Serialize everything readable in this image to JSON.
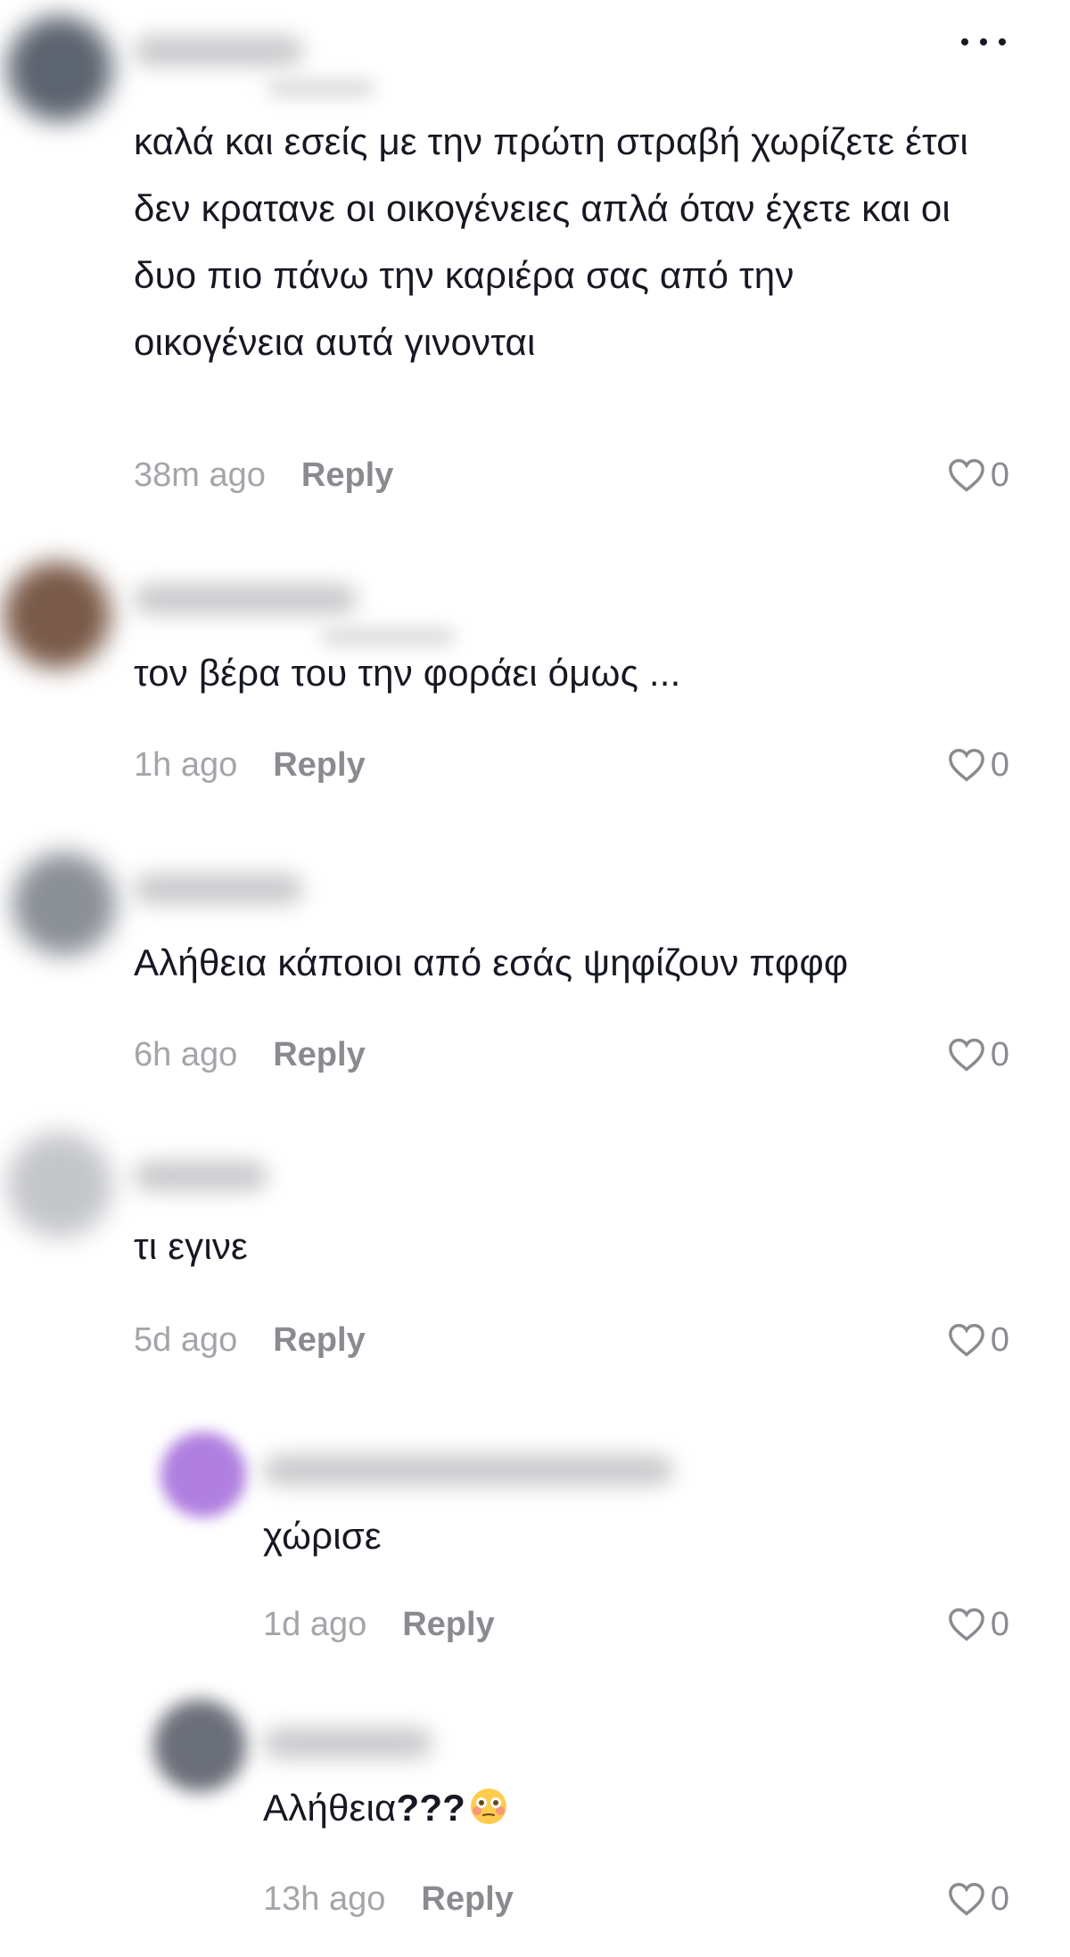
{
  "more_menu_label": "...",
  "reply_label": "Reply",
  "comments": [
    {
      "text": "καλά και εσείς με την πρώτη στραβή χωρίζετε έτσι δεν κρατανε οι οικογένειες απλά όταν έχετε και οι δυο πιο πάνω την καριέρα σας από την οικογένεια αυτά γινονται",
      "time": "38m ago",
      "likes": "0"
    },
    {
      "text": "τον βέρα του την φοράει όμως ...",
      "time": "1h ago",
      "likes": "0"
    },
    {
      "text": "Αλήθεια κάποιοι από εσάς ψηφίζουν πφφφ",
      "time": "6h ago",
      "likes": "0"
    },
    {
      "text": "τι εγινε",
      "time": "5d ago",
      "likes": "0"
    }
  ],
  "replies": [
    {
      "text": "χώρισε",
      "time": "1d ago",
      "likes": "0"
    },
    {
      "text_main": "Αλήθεια",
      "text_bold": "???",
      "emoji": "flushed-face",
      "time": "13h ago",
      "likes": "0"
    }
  ]
}
